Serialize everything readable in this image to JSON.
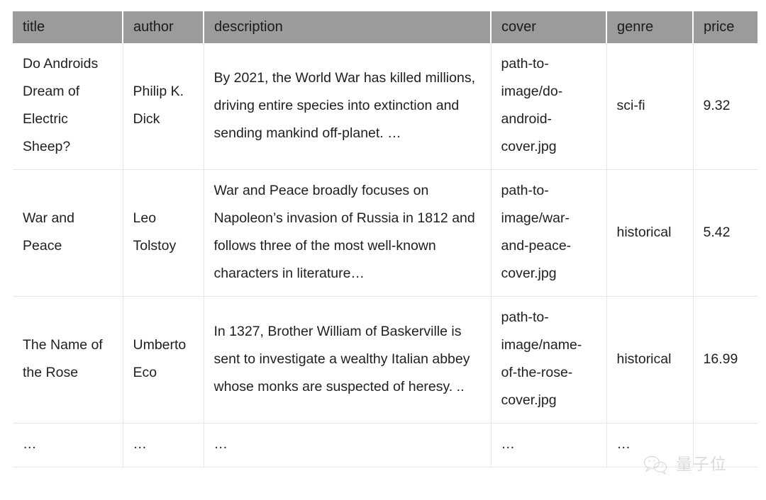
{
  "table": {
    "columns": [
      {
        "key": "title",
        "label": "title"
      },
      {
        "key": "author",
        "label": "author"
      },
      {
        "key": "description",
        "label": "description"
      },
      {
        "key": "cover",
        "label": "cover"
      },
      {
        "key": "genre",
        "label": "genre"
      },
      {
        "key": "price",
        "label": "price"
      }
    ],
    "rows": [
      {
        "title": "Do Androids Dream of Electric Sheep?",
        "author": "Philip K. Dick",
        "description": "By 2021, the World War has killed millions, driving entire species into extinction and sending mankind off-planet. …",
        "cover": "path-to-image/do-android-cover.jpg",
        "genre": "sci-fi",
        "price": "9.32"
      },
      {
        "title": "War and Peace",
        "author": "Leo Tolstoy",
        "description": "War and Peace broadly focuses on Napoleon’s invasion of Russia in 1812 and follows three of the most well-known characters in literature…",
        "cover": "path-to-image/war-and-peace-cover.jpg",
        "genre": "historical",
        "price": "5.42"
      },
      {
        "title": "The Name of the Rose",
        "author": "Umberto Eco",
        "description": "In 1327, Brother William of Baskerville is sent to investigate a wealthy Italian abbey whose monks are suspected of heresy. ..",
        "cover": "path-to-image/name-of-the-rose-cover.jpg",
        "genre": "historical",
        "price": "16.99"
      },
      {
        "title": "…",
        "author": "…",
        "description": "…",
        "cover": "…",
        "genre": "…",
        "price": ""
      }
    ]
  },
  "watermark": {
    "text": "量子位",
    "logo": "wechat-logo-icon"
  },
  "colors": {
    "header_background": "#9b9b9b",
    "header_text": "#1b1b1b",
    "cell_text": "#1f1f1f",
    "grid_line": "#e6e6e6",
    "page_background": "#ffffff"
  }
}
